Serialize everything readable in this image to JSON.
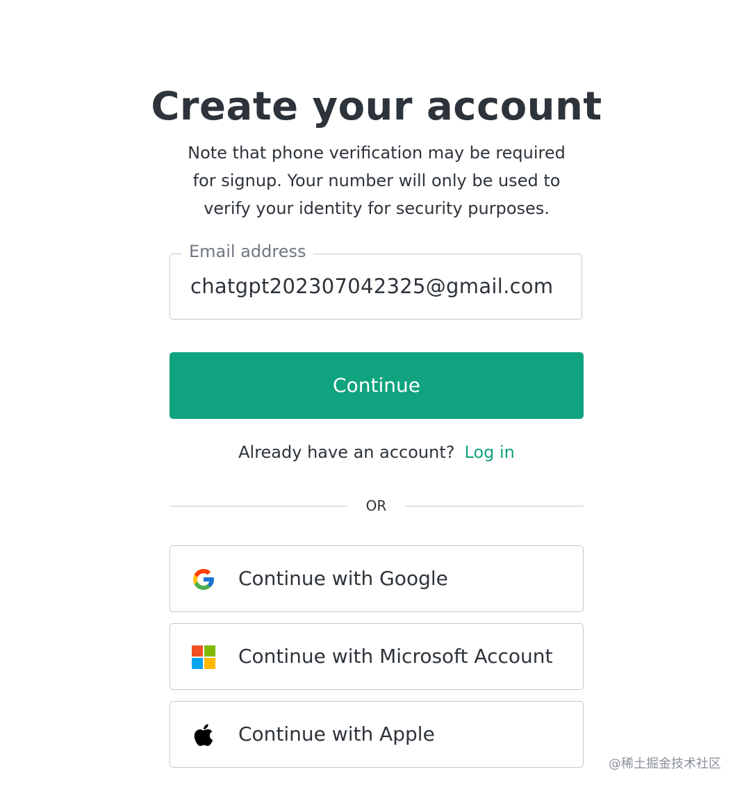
{
  "page": {
    "title": "Create your account",
    "subtitle": "Note that phone verification may be required for signup. Your number will only be used to verify your identity for security purposes."
  },
  "email": {
    "label": "Email address",
    "value": "chatgpt202307042325@gmail.com"
  },
  "continue_label": "Continue",
  "login": {
    "prompt": "Already have an account?",
    "link": "Log in"
  },
  "divider_text": "OR",
  "social": {
    "google": "Continue with Google",
    "microsoft": "Continue with Microsoft Account",
    "apple": "Continue with Apple"
  },
  "watermark": "@稀土掘金技术社区",
  "colors": {
    "accent": "#10a37f",
    "text": "#2d333a",
    "border": "#c2c8d0",
    "muted": "#6f7780"
  },
  "icons": {
    "google": "google-logo-icon",
    "microsoft": "microsoft-logo-icon",
    "apple": "apple-logo-icon"
  }
}
